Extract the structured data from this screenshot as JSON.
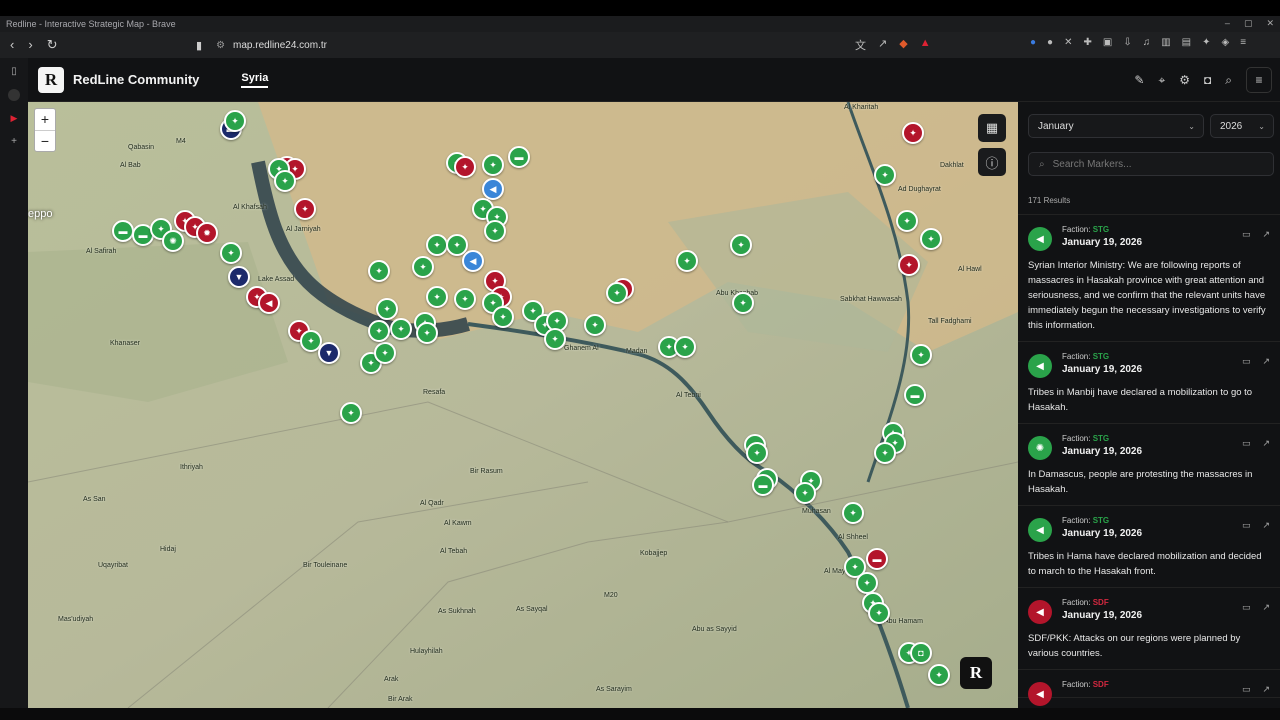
{
  "browser": {
    "window_title": "Redline - Interactive Strategic Map - Brave",
    "url": "map.redline24.com.tr"
  },
  "app": {
    "logo_letter": "R",
    "brand": "RedLine Community",
    "active_tab": "Syria"
  },
  "map": {
    "zoom_in": "+",
    "zoom_out": "−",
    "labels": [
      "Qabasin",
      "Al Bab",
      "eppo",
      "Al Safirah",
      "Al Khafsah",
      "Al Jarniyah",
      "Lake Assad",
      "Khanaser",
      "Resafa",
      "Ithriyah",
      "As San",
      "Uqayribat",
      "Hidaj",
      "Mas'udiyah",
      "Al Qadr",
      "Bir Rasum",
      "Al Kawm",
      "Al Tebah",
      "Bir Touleinane",
      "As Sukhnah",
      "Hulayhilah",
      "Arak",
      "Bir Arak",
      "As Sayqal",
      "Kobajjep",
      "Abu as Sayyid",
      "As Sarayim",
      "Ghanem Al",
      "Madan",
      "Al Tebni",
      "Muhasan",
      "Al Shheel",
      "Al Mayadin",
      "Abu Hamam",
      "Al Kharitah",
      "Ad Dughayrat",
      "Abu Khashab",
      "Tall Fadghami",
      "Sabkhat Hawwasah",
      "Dakhlat",
      "Al Hawl",
      "M20",
      "M4"
    ],
    "rbadge": "R"
  },
  "sidebar": {
    "month": "January",
    "year": "2026",
    "search_placeholder": "Search Markers...",
    "results": "171 Results",
    "items": [
      {
        "faction_label": "Faction:",
        "faction": "STG",
        "faction_color": "#2aa34a",
        "date": "January 19, 2026",
        "text": "Syrian Interior Ministry: We are following reports of massacres in Hasakah province with great attention and seriousness, and we confirm that the relevant units have immediately begun the necessary investigations to verify this information."
      },
      {
        "faction_label": "Faction:",
        "faction": "STG",
        "faction_color": "#2aa34a",
        "date": "January 19, 2026",
        "text": "Tribes in Manbij have declared a mobilization to go to Hasakah."
      },
      {
        "faction_label": "Faction:",
        "faction": "STG",
        "faction_color": "#2aa34a",
        "date": "January 19, 2026",
        "text": "In Damascus, people are protesting the massacres in Hasakah."
      },
      {
        "faction_label": "Faction:",
        "faction": "STG",
        "faction_color": "#2aa34a",
        "date": "January 19, 2026",
        "text": "Tribes in Hama have declared mobilization and decided to march to the Hasakah front."
      },
      {
        "faction_label": "Faction:",
        "faction": "SDF",
        "faction_color": "#b3152b",
        "date": "January 19, 2026",
        "text": "SDF/PKK: Attacks on our regions were planned by various countries."
      },
      {
        "faction_label": "Faction:",
        "faction": "SDF",
        "faction_color": "#b3152b",
        "date": "",
        "text": ""
      }
    ]
  }
}
